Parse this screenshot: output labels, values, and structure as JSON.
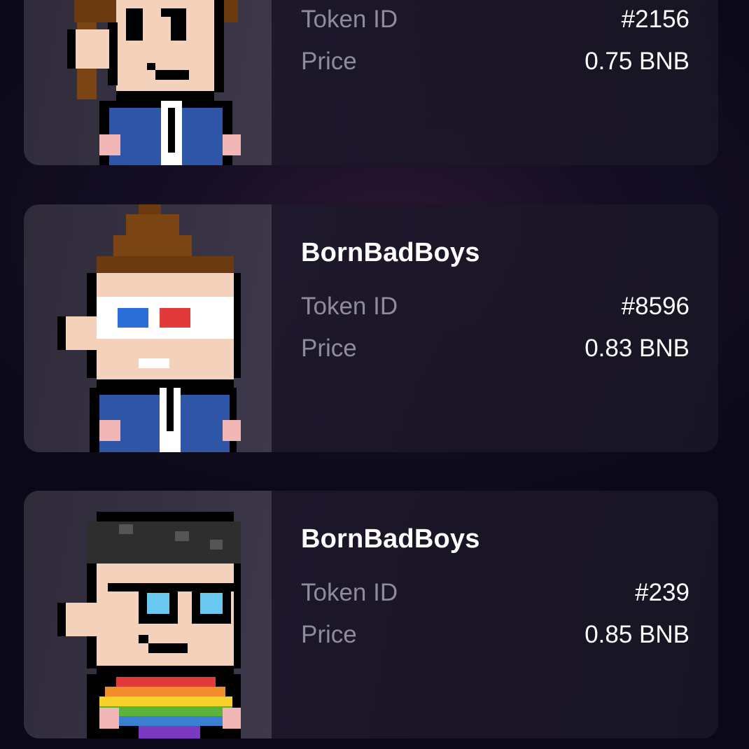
{
  "listings": [
    {
      "collection": "",
      "token_id_label": "Token ID",
      "token_id": "#2156",
      "price_label": "Price",
      "price": "0.75 BNB"
    },
    {
      "collection": "BornBadBoys",
      "token_id_label": "Token ID",
      "token_id": "#8596",
      "price_label": "Price",
      "price": "0.83 BNB"
    },
    {
      "collection": "BornBadBoys",
      "token_id_label": "Token ID",
      "token_id": "#239",
      "price_label": "Price",
      "price": "0.85 BNB"
    }
  ],
  "colors": {
    "background": "#0b0918",
    "card": "#1f1a2e",
    "thumbnail": "#3a3646",
    "label": "#8f8c9a",
    "value": "#ffffff"
  }
}
